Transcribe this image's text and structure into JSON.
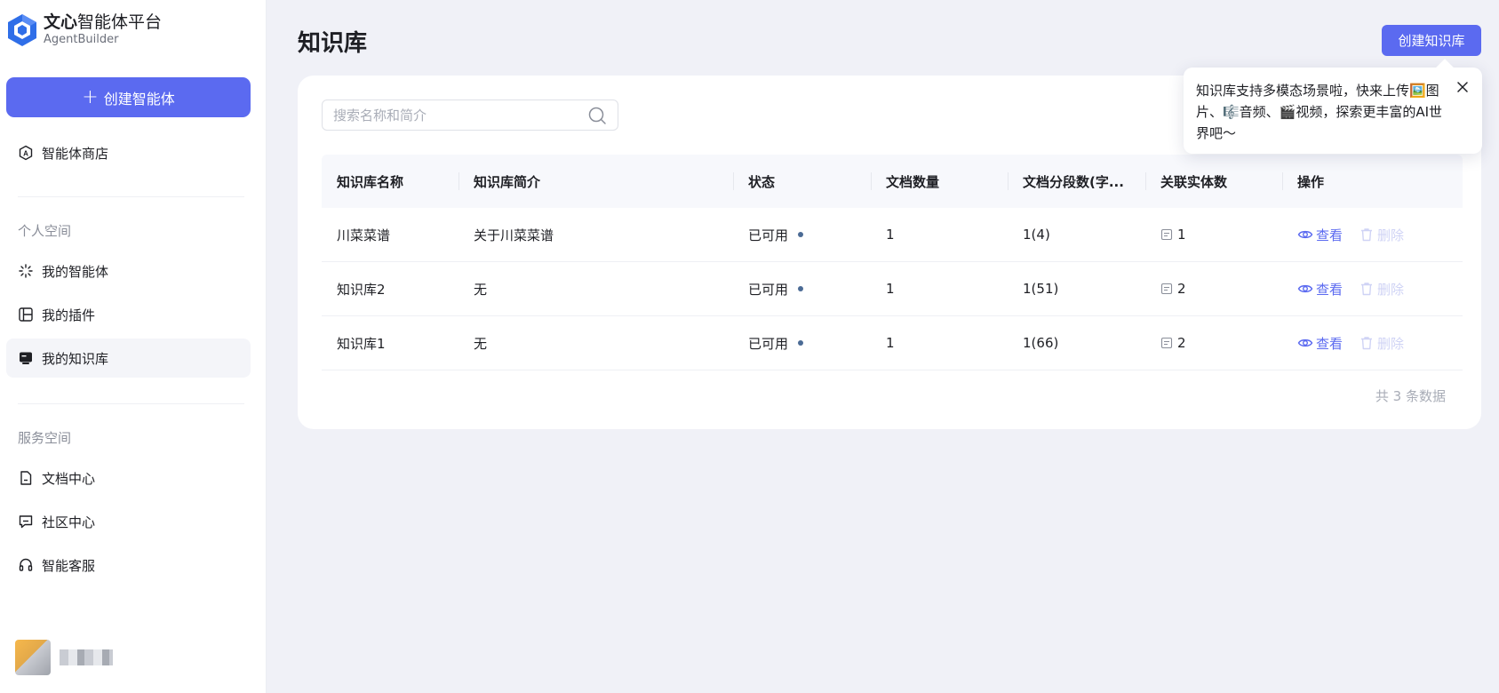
{
  "app": {
    "name_bold": "文心",
    "name_rest": "智能体平台",
    "subtitle": "AgentBuilder"
  },
  "sidebar": {
    "create_label": "创建智能体",
    "store_label": "智能体商店",
    "personal_section": "个人空间",
    "personal_items": [
      {
        "label": "我的智能体",
        "icon": "sparkle-icon"
      },
      {
        "label": "我的插件",
        "icon": "plugin-icon"
      },
      {
        "label": "我的知识库",
        "icon": "knowledge-base-icon",
        "active": true
      }
    ],
    "service_section": "服务空间",
    "service_items": [
      {
        "label": "文档中心",
        "icon": "document-icon"
      },
      {
        "label": "社区中心",
        "icon": "chat-icon"
      },
      {
        "label": "智能客服",
        "icon": "headset-icon"
      }
    ]
  },
  "main": {
    "title": "知识库",
    "create_button": "创建知识库",
    "search_placeholder": "搜索名称和简介",
    "columns": [
      "知识库名称",
      "知识库简介",
      "状态",
      "文档数量",
      "文档分段数(字...",
      "关联实体数",
      "操作"
    ],
    "rows": [
      {
        "name": "川菜菜谱",
        "desc": "关于川菜菜谱",
        "status": "已可用",
        "docs": "1",
        "segments": "1(4)",
        "entities": "1"
      },
      {
        "name": "知识库2",
        "desc": "无",
        "status": "已可用",
        "docs": "1",
        "segments": "1(51)",
        "entities": "2"
      },
      {
        "name": "知识库1",
        "desc": "无",
        "status": "已可用",
        "docs": "1",
        "segments": "1(66)",
        "entities": "2"
      }
    ],
    "view_label": "查看",
    "delete_label": "删除",
    "total_label": "共 3 条数据"
  },
  "tooltip": {
    "text": "知识库支持多模态场景啦，快来上传🖼️图片、🎼音频、🎬视频，探索更丰富的AI世界吧～"
  },
  "colors": {
    "accent": "#5b6af0",
    "background": "#f0f1f7",
    "status_dot": "#4b6b95"
  }
}
